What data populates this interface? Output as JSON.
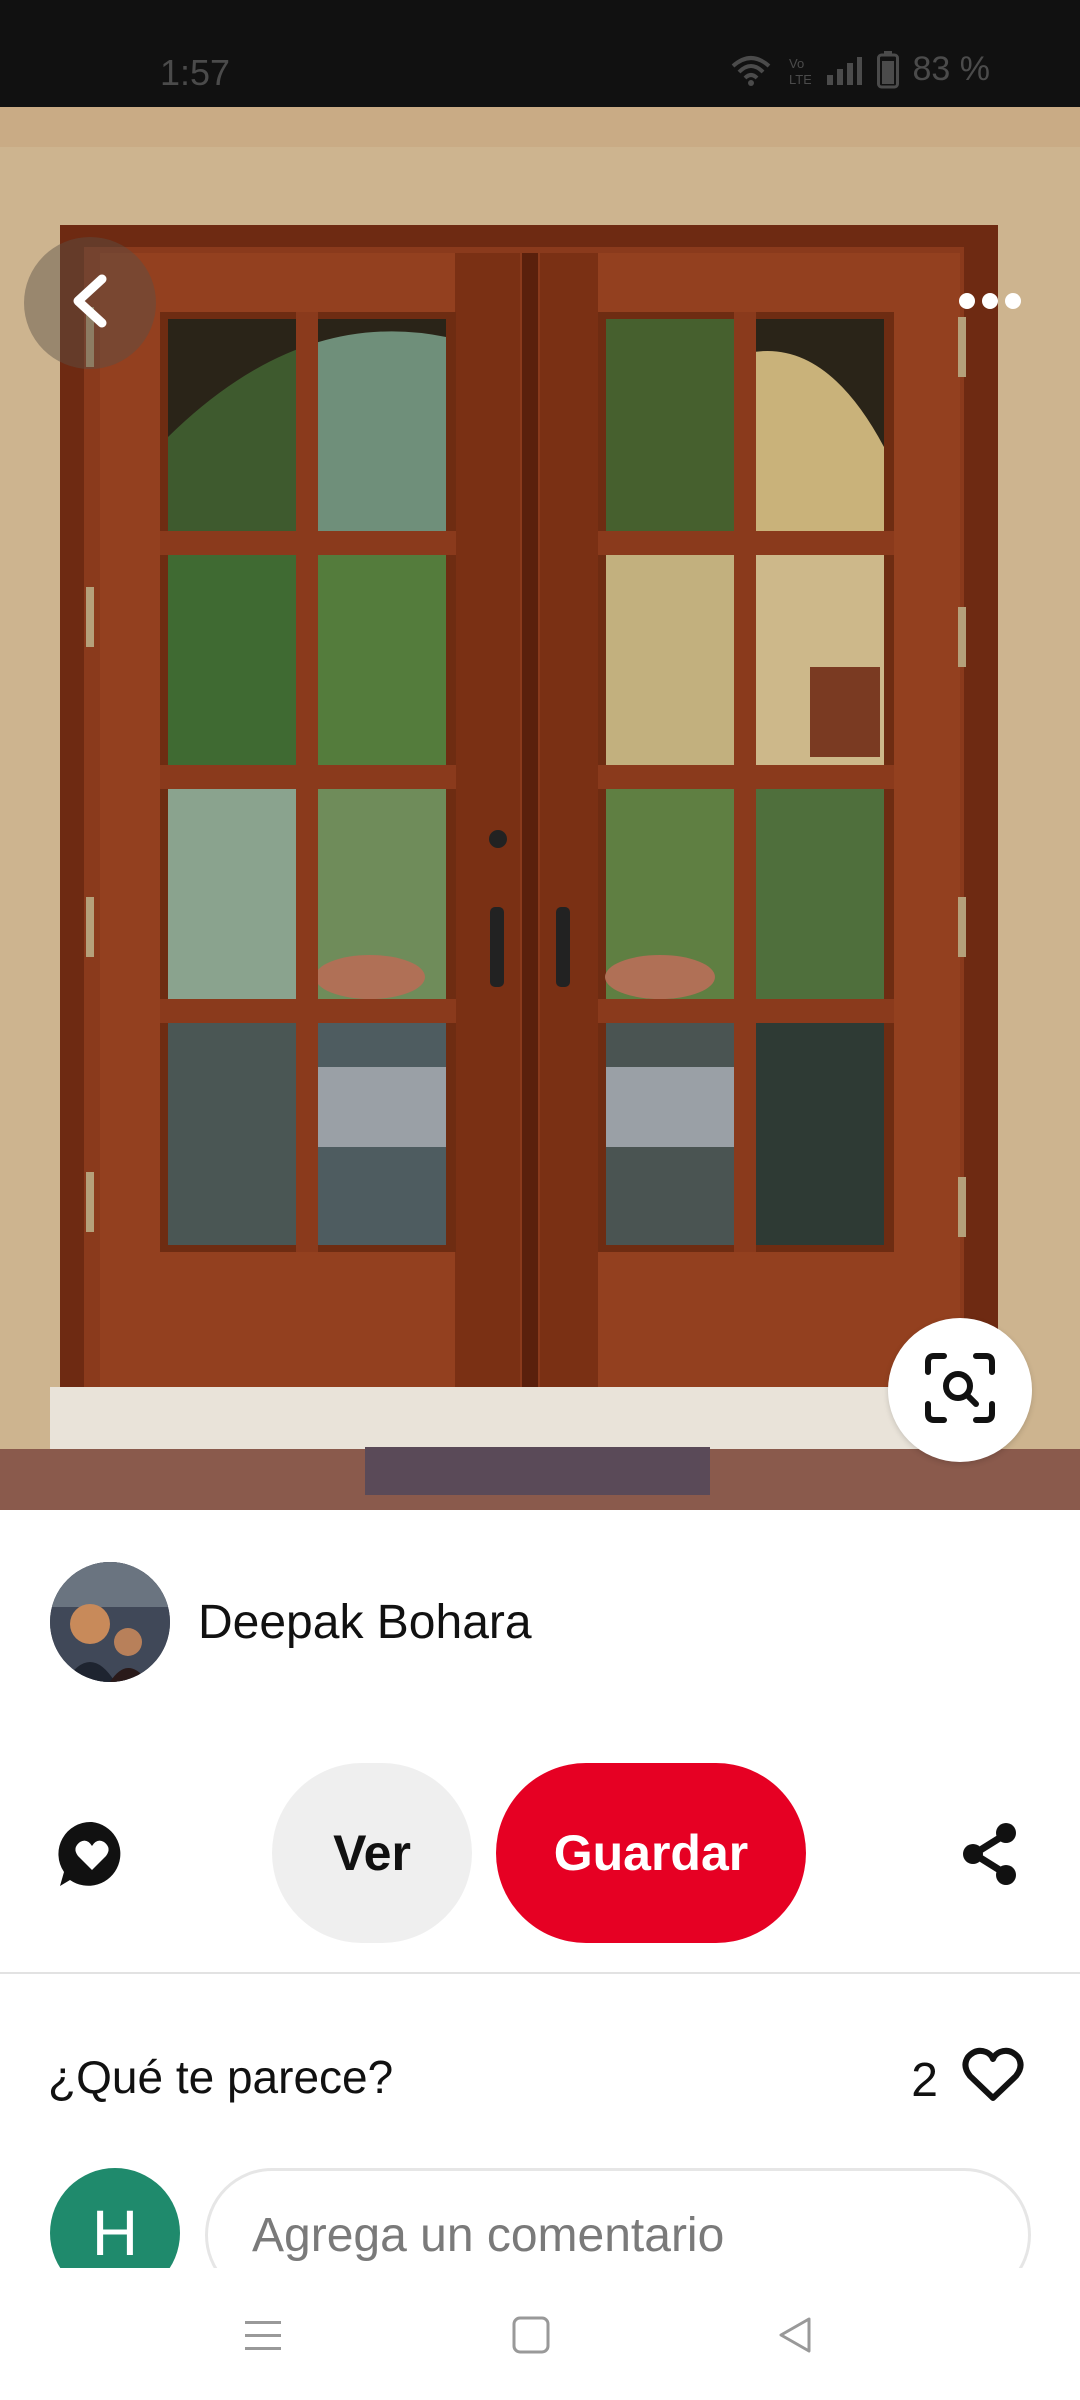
{
  "status_bar": {
    "time": "1:57",
    "battery": "83 %"
  },
  "pin": {
    "author_name": "Deepak Bohara"
  },
  "actions": {
    "view_label": "Ver",
    "save_label": "Guardar"
  },
  "comments": {
    "heading": "¿Qué te parece?",
    "like_count": "2",
    "user_initial": "H",
    "input_placeholder": "Agrega un comentario"
  },
  "colors": {
    "save_red": "#e60023",
    "avatar_green": "#1f8a6c",
    "status_bar_bg": "#111111"
  },
  "icons": [
    "back-arrow-icon",
    "more-icon",
    "visual-search-icon",
    "reaction-icon",
    "share-icon",
    "heart-icon",
    "menu-icon",
    "home-icon",
    "back-icon",
    "wifi-icon",
    "signal-icon",
    "battery-icon"
  ]
}
